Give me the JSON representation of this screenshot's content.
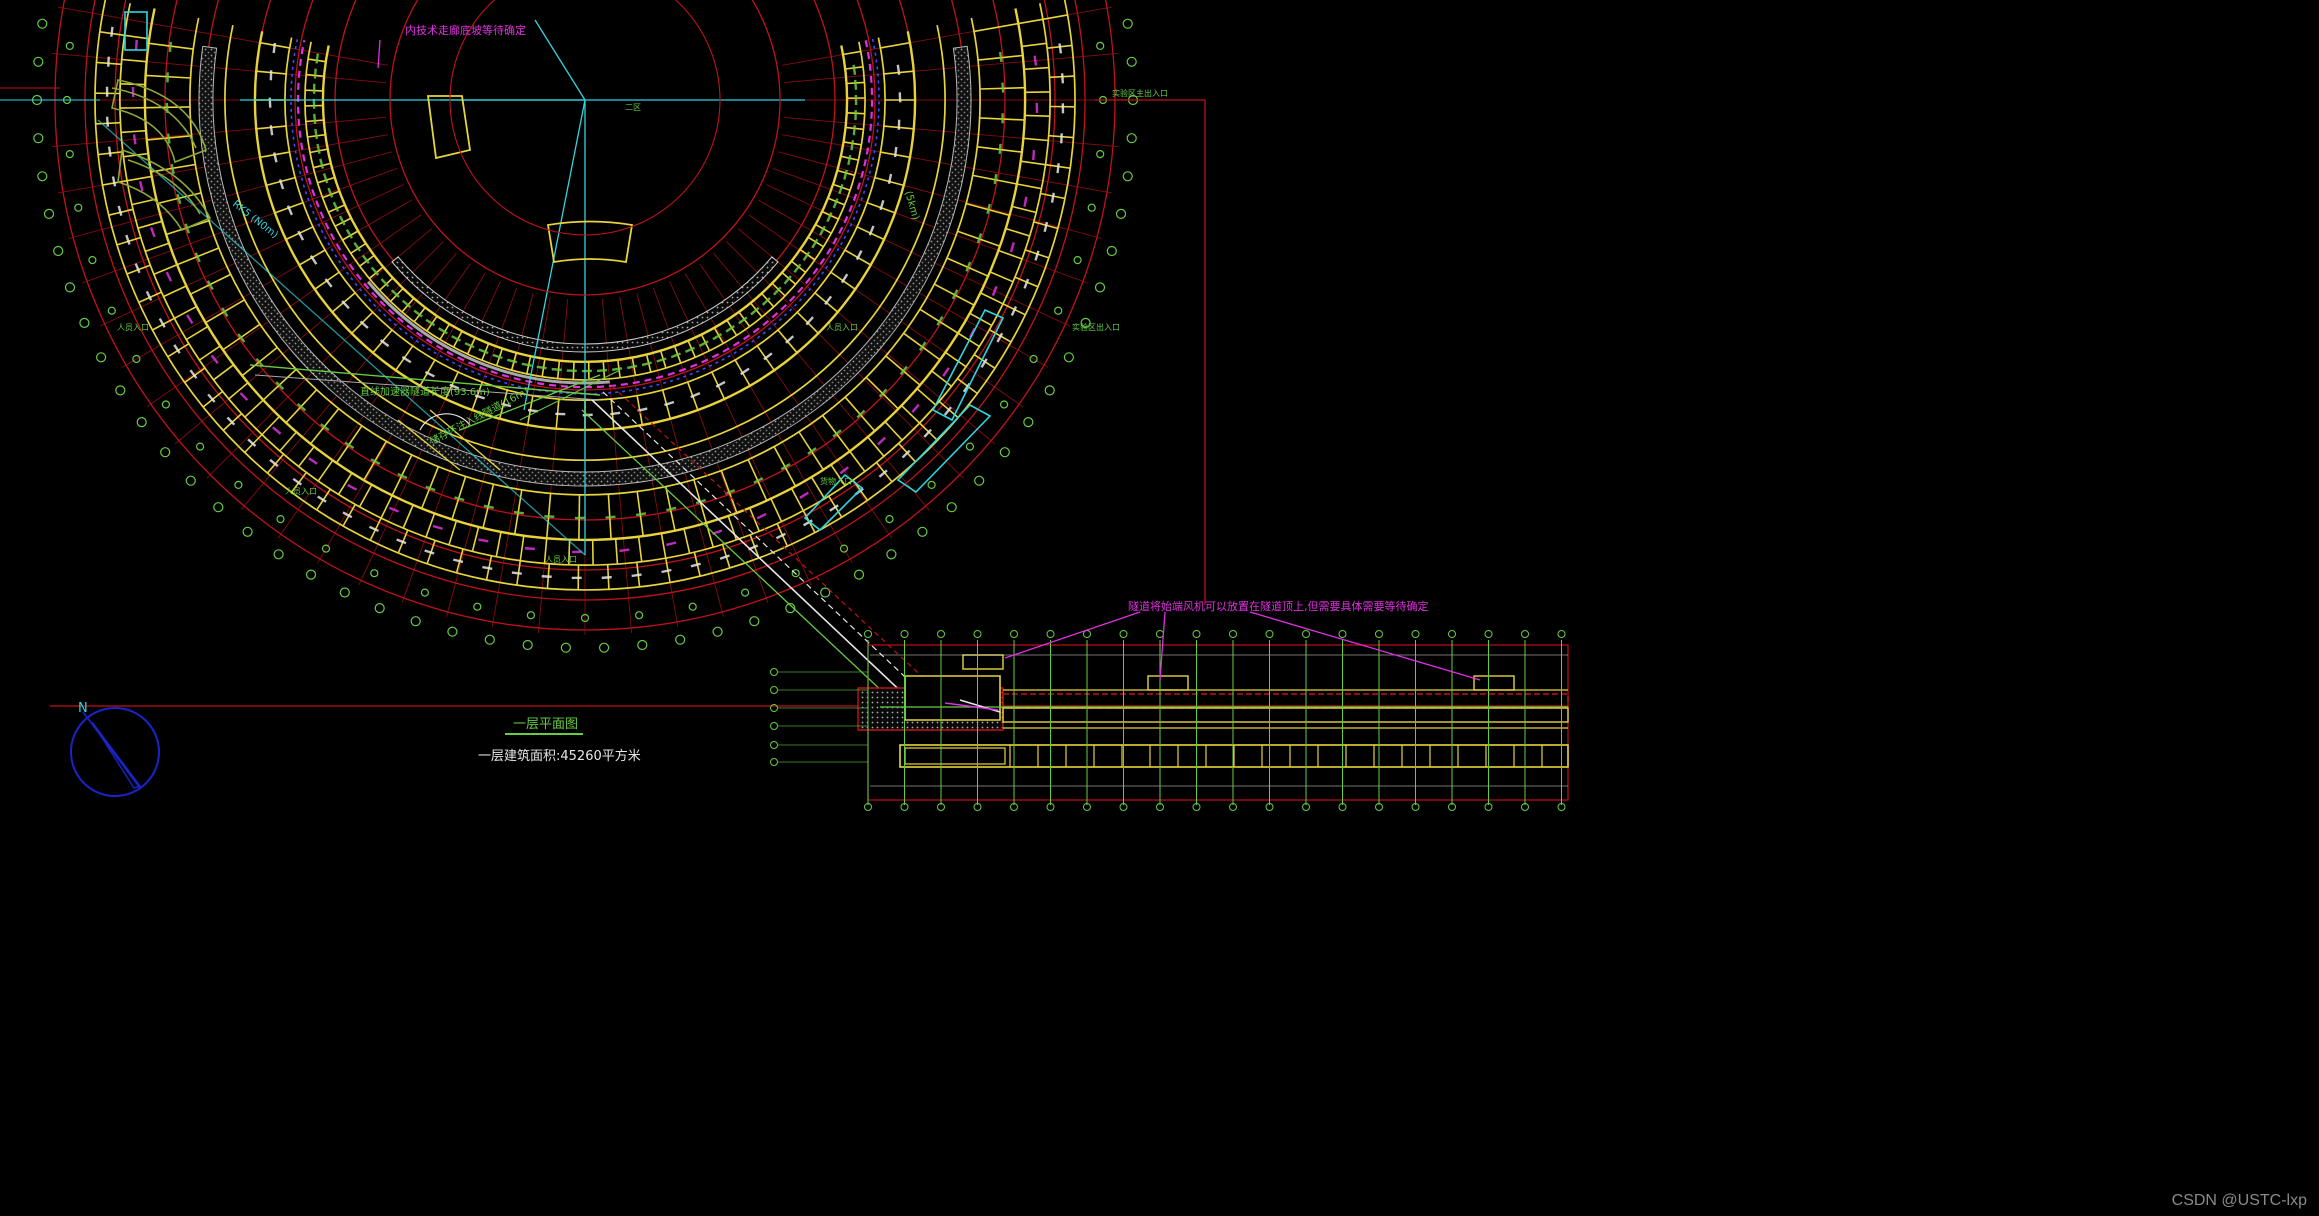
{
  "drawing": {
    "title": "一层平面图",
    "area_note": "一层建筑面积:45260平方米",
    "north_label": "N",
    "watermark": "CSDN @USTC-lxp"
  },
  "annotations": {
    "inner_magenta": "内技术走廊底坡等待确定",
    "magenta_note": "隧道将始端风机可以放置在隧道顶上,但需要具体需要等待确定",
    "cyan_radial": "RK5 (N0m)",
    "tunnel_label_1": "直线加速器隧道长度(93.6m)",
    "tunnel_label_2": "储存环注入线隧道(16m)",
    "green_dim": "(5km)",
    "wedge_label": "二区"
  },
  "entrances": {
    "main_entrance": "实验区主出入口",
    "exp_entrance": "实验区出入口",
    "goods_entrance": "货物入口",
    "people_entrance_1": "人员入口",
    "people_entrance_2": "人员入口",
    "people_entrance_3": "人员入口",
    "people_entrance_4": "人员入口"
  },
  "colors": {
    "background": "#000000",
    "wall": "#e8d43a",
    "grid_red": "#c0121b",
    "cyan": "#2fd6e0",
    "magenta": "#e030e0",
    "green": "#66cc44",
    "white": "#e6e6e6",
    "compass": "#1a24c8"
  },
  "room_label": "设备间"
}
